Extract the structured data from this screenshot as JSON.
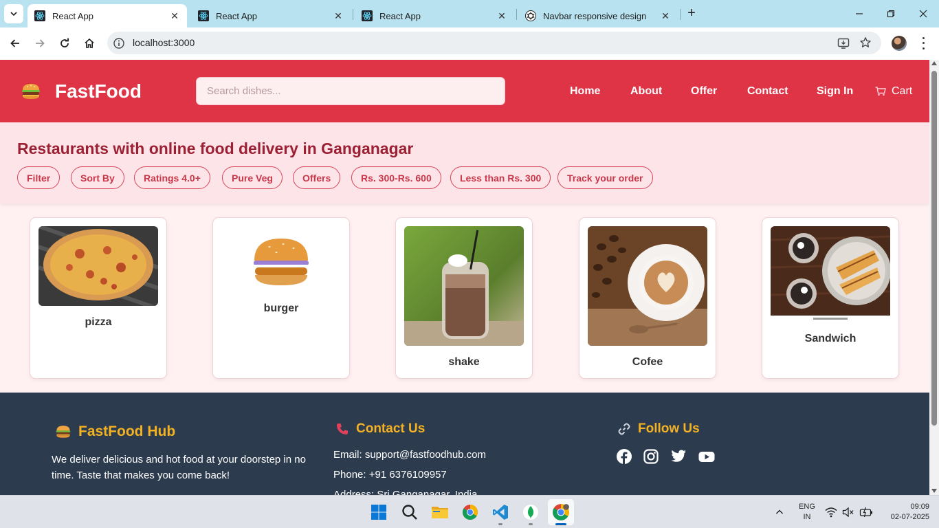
{
  "browser": {
    "tabs": [
      {
        "title": "React App",
        "active": true,
        "icon": "react-icon"
      },
      {
        "title": "React App",
        "active": false,
        "icon": "react-icon"
      },
      {
        "title": "React App",
        "active": false,
        "icon": "react-icon"
      },
      {
        "title": "Navbar responsive design",
        "active": false,
        "icon": "openai-icon"
      }
    ],
    "url": "localhost:3000"
  },
  "site": {
    "brand": "FastFood",
    "search_placeholder": "Search dishes...",
    "nav": [
      "Home",
      "About",
      "Offer",
      "Contact",
      "Sign In"
    ],
    "cart_label": "Cart",
    "accent": "#de3446"
  },
  "hero": {
    "title": "Restaurants with online food delivery in Ganganagar",
    "chips": [
      "Filter",
      "Sort By",
      "Ratings 4.0+",
      "Pure Veg",
      "Offers",
      "Rs. 300-Rs. 600",
      "Less than Rs. 300",
      "Track your order"
    ]
  },
  "foods": [
    {
      "name": "pizza"
    },
    {
      "name": "burger"
    },
    {
      "name": "shake"
    },
    {
      "name": "Cofee"
    },
    {
      "name": "Sandwich"
    }
  ],
  "footer": {
    "brand_title": "FastFood Hub",
    "about": "We deliver delicious and hot food at your doorstep in no time. Taste that makes you come back!",
    "contact_title": "Contact Us",
    "email": "Email: support@fastfoodhub.com",
    "phone": "Phone: +91 6376109957",
    "address": "Address: Sri Ganganagar, India",
    "follow_title": "Follow Us",
    "social": [
      "facebook-icon",
      "instagram-icon",
      "twitter-icon",
      "youtube-icon"
    ]
  },
  "taskbar": {
    "lang_line1": "ENG",
    "lang_line2": "IN",
    "time": "09:09",
    "date": "02-07-2025"
  }
}
